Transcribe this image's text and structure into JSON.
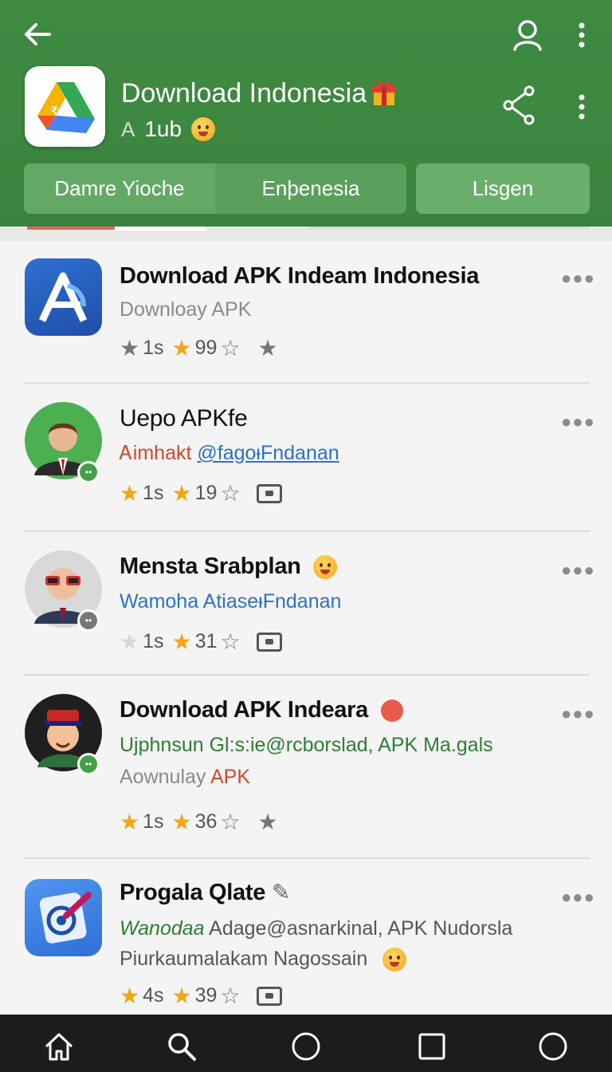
{
  "header": {
    "title": "Download Indonesia",
    "subtitle_glyph": "A",
    "subtitle_text": "1ub",
    "tabs": [
      {
        "label": "Damre Yioche"
      },
      {
        "label": "Enþenesia"
      },
      {
        "label": "Lisgen"
      }
    ]
  },
  "apps": [
    {
      "title": "Download APK Indeam Indonesia",
      "line1": "Downloay APK",
      "rating_a": "1s",
      "rating_b": "99"
    },
    {
      "title": "Uepo APKfe",
      "line1_red": "Ꭺimhakt",
      "line1_blue": "@fagoᵻFndanan",
      "rating_a": "1s",
      "rating_b": "19"
    },
    {
      "title": "Mensta Srabplan",
      "line1": "Wamoha AtiaseᵻFndanan",
      "rating_a": "1s",
      "rating_b": "31"
    },
    {
      "title": "Download APK Indeara",
      "line1": "Ujphnsun Gl:s:ie@rcborslad, APK Ma.gals",
      "line2_grey": "Aownulay",
      "line2_red": "APK",
      "rating_a": "1s",
      "rating_b": "36"
    },
    {
      "title": "Progala Qlate",
      "line1_green": "Wanodaa",
      "line1_grey": "Adage@asnarkinal, APK Nudorsla",
      "line2": "Piurkaumalakam Nagossain",
      "rating_a": "4s",
      "rating_b": "39"
    }
  ],
  "icons": {
    "back": "back-arrow-icon",
    "profile": "user-icon",
    "menu": "kebab-menu-icon",
    "share": "share-icon",
    "nav": [
      "home-icon",
      "search-icon",
      "circle-icon",
      "square-icon",
      "circle-icon"
    ]
  },
  "colors": {
    "header_green": "#3f8a41",
    "tab_green": "#64a866",
    "star_gold": "#f2a516",
    "link_blue": "#2a72c8",
    "nav_bg": "#1c1c1c"
  }
}
